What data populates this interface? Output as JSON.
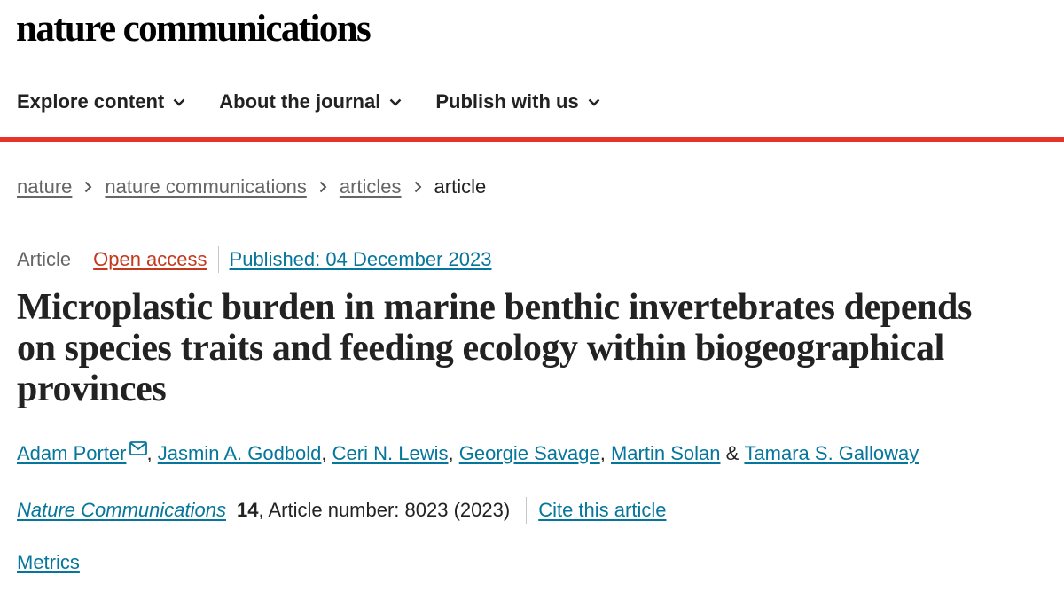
{
  "site": {
    "logo": "nature communications"
  },
  "nav": {
    "items": [
      {
        "label": "Explore content",
        "icon": "chevron-down-icon"
      },
      {
        "label": "About the journal",
        "icon": "chevron-down-icon"
      },
      {
        "label": "Publish with us",
        "icon": "chevron-down-icon"
      }
    ]
  },
  "breadcrumb": {
    "items": [
      "nature",
      "nature communications",
      "articles"
    ],
    "current": "article"
  },
  "article": {
    "type": "Article",
    "access": "Open access",
    "published": "Published: 04 December 2023",
    "title": "Microplastic burden in marine benthic invertebrates depends on species traits and feeding ecology within biogeographical provinces",
    "authors": [
      "Adam Porter",
      "Jasmin A. Godbold",
      "Ceri N. Lewis",
      "Georgie Savage",
      "Martin Solan",
      "Tamara S. Galloway"
    ],
    "separator": ",",
    "ampersand": "&",
    "journal": "Nature Communications",
    "volume": "14",
    "article_number": ", Article number: 8023 (2023)",
    "cite_label": "Cite this article",
    "metrics_label": "Metrics"
  },
  "colors": {
    "accent_red": "#e8332a",
    "link_blue": "#06769c",
    "open_access_orange": "#c4391d",
    "text_grey": "#666666"
  }
}
